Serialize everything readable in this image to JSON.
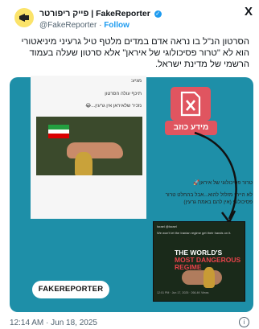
{
  "header": {
    "account_name": "פייק ריפורטר | FakeReporter",
    "handle": "@FakeReporter",
    "separator": "·",
    "follow_label": "Follow",
    "x_logo": "X"
  },
  "tweet": {
    "text": "הסרטון הנ\"ל בו נראה אדם במדים מלטף טיל גרעיני מיניאטורי הוא לא \"טרור פסיכולוגי של איראן\" אלא סרטון שעלה בעמוד הרשמי של מדינת ישראל."
  },
  "media": {
    "bg_color": "#1e8fa8",
    "left_card": {
      "lines": [
        "מגיע:",
        "תיכף עולה הסרטון",
        "נזכיר שלאיראן אין גרעין...😂"
      ],
      "caption1": "טרור פסיכולוגי של איראן🚀",
      "caption2": "לא הייתי מזלזל להוא...אבל בהחלט טרור פסיכולוגי (אין להם באמת גרעין)"
    },
    "false_badge": {
      "label": "מידע כוזב",
      "color": "#e05560"
    },
    "right_screenshot": {
      "handle": "Israel @Israel",
      "subtitle": "We won't let the Iranian regime get their hands on it.",
      "title_line1": "THE WORLD'S",
      "title_line2": "MOST DANGEROUS",
      "title_line3": "REGIME",
      "meta": "12:01 PM · Jun 17, 2025 · 266.4K Views"
    },
    "logo": {
      "part1": "FAKE",
      "part2": "REPORTER"
    }
  },
  "footer": {
    "timestamp": "12:14 AM · Jun 18, 2025",
    "info_icon": "i"
  }
}
